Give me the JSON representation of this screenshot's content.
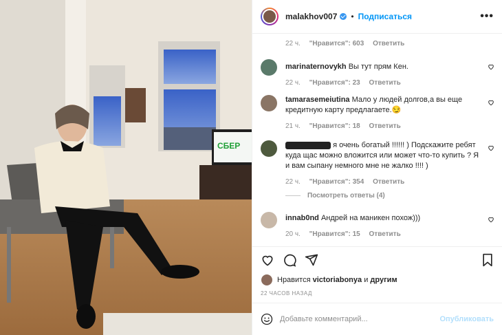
{
  "post": {
    "username": "malakhov007",
    "follow_label": "Подписаться",
    "dot": "•",
    "more": "•••"
  },
  "photo": {
    "tv_brand": "СБЕР"
  },
  "top_meta": {
    "time": "22 ч.",
    "likes": "\"Нравится\": 603",
    "reply": "Ответить"
  },
  "comments": [
    {
      "username": "marinaternovykh",
      "text": "Вы тут прям Кен.",
      "time": "22 ч.",
      "likes": "\"Нравится\": 23",
      "reply": "Ответить"
    },
    {
      "username": "tamarasemeiutina",
      "text": "Мало у людей долгов,а вы еще кредитную карту предлагаете.😏",
      "time": "21 ч.",
      "likes": "\"Нравится\": 18",
      "reply": "Ответить"
    },
    {
      "username": "",
      "text": "я очень богатый !!!!!! ) Подскажите ребят куда щас можно вложится или может что-то купить ? Я и вам сыпану немного мне не жалко !!!! )",
      "time": "22 ч.",
      "likes": "\"Нравится\": 354",
      "reply": "Ответить"
    },
    {
      "username": "innab0nd",
      "text": "Андрей на маникен похож)))",
      "time": "20 ч.",
      "likes": "\"Нравится\": 15",
      "reply": "Ответить"
    }
  ],
  "view_replies": "Посмотреть ответы (4)",
  "likes_line": {
    "prefix": "Нравится",
    "user": "victoriabonya",
    "and": "и",
    "others": "другим"
  },
  "timestamp": "22 ЧАСОВ НАЗАД",
  "add_comment": {
    "placeholder": "Добавьте комментарий...",
    "publish": "Опубликовать"
  }
}
